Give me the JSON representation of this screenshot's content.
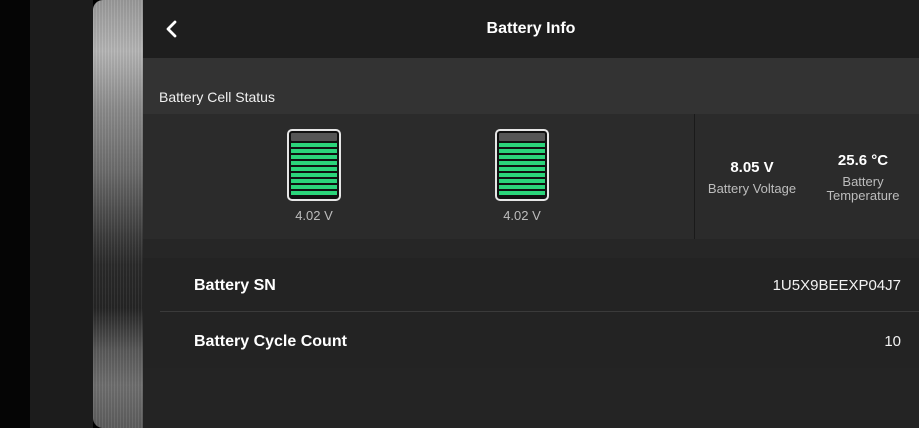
{
  "header": {
    "title": "Battery Info",
    "back_icon": "chevron-left-icon"
  },
  "cell_status": {
    "section_label": "Battery Cell Status",
    "cells": [
      {
        "voltage": "4.02 V",
        "level": 1.0,
        "color": "#2bd47a"
      },
      {
        "voltage": "4.02 V",
        "level": 1.0,
        "color": "#2bd47a"
      }
    ],
    "voltage": {
      "value": "8.05 V",
      "label": "Battery Voltage"
    },
    "temperature": {
      "value": "25.6 °C",
      "label_line1": "Battery",
      "label_line2": "Temperature"
    }
  },
  "details": {
    "rows": [
      {
        "label": "Battery SN",
        "value": "1U5X9BEEXP04J7"
      },
      {
        "label": "Battery Cycle Count",
        "value": "10"
      }
    ]
  }
}
